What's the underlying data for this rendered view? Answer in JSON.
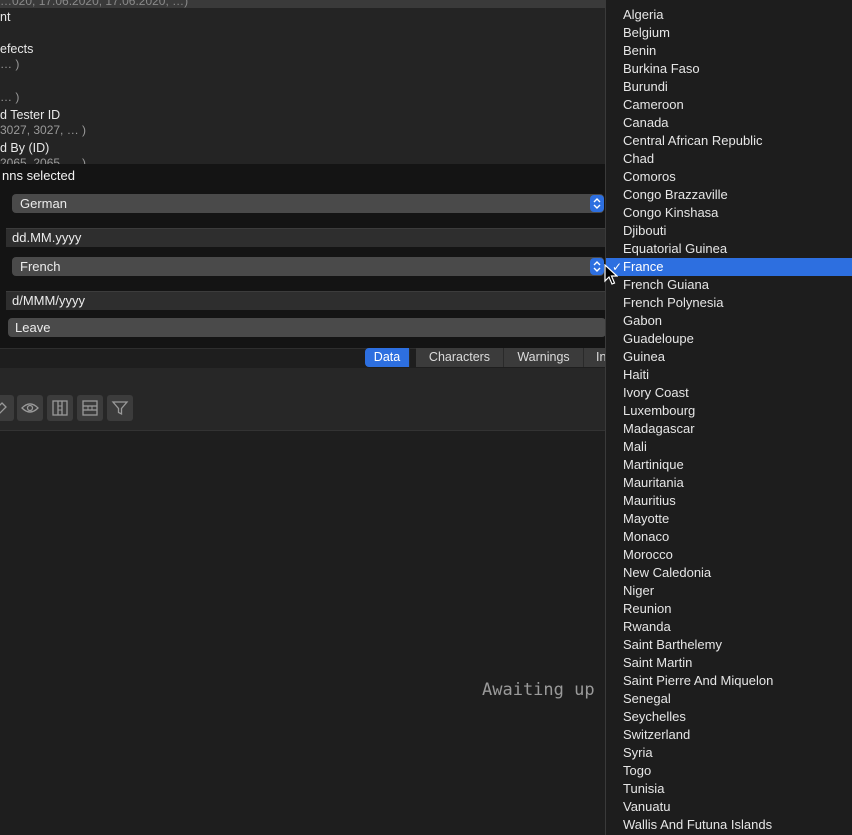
{
  "preview": {
    "top_sample": "…020, 17.06.2020, 17.06.2020, …)",
    "columns": [
      {
        "name": "nt",
        "sample": ""
      },
      {
        "name": "efects",
        "sample": "… )"
      },
      {
        "name": "",
        "sample": "… )"
      },
      {
        "name": "d Tester ID",
        "sample": "3027, 3027, … )"
      },
      {
        "name": "d By (ID)",
        "sample": "2065, 2065, … )"
      }
    ]
  },
  "settings": {
    "selection_label": "nns selected",
    "language_1": "German",
    "date_format_1": "dd.MM.yyyy",
    "language_2": "French",
    "date_format_2": "d/MMM/yyyy",
    "action": "Leave"
  },
  "tabs": [
    "Data",
    "Characters",
    "Warnings",
    "In"
  ],
  "active_tab": "Data",
  "toolbar": {
    "icons": [
      "pencil-icon",
      "eye-icon",
      "columns-icon",
      "rows-icon",
      "filter-icon"
    ]
  },
  "status": {
    "text": "Awaiting up"
  },
  "menu": {
    "selected": "France",
    "check_glyph": "✓",
    "items": [
      "Algeria",
      "Belgium",
      "Benin",
      "Burkina Faso",
      "Burundi",
      "Cameroon",
      "Canada",
      "Central African Republic",
      "Chad",
      "Comoros",
      "Congo Brazzaville",
      "Congo Kinshasa",
      "Djibouti",
      "Equatorial Guinea",
      "France",
      "French Guiana",
      "French Polynesia",
      "Gabon",
      "Guadeloupe",
      "Guinea",
      "Haiti",
      "Ivory Coast",
      "Luxembourg",
      "Madagascar",
      "Mali",
      "Martinique",
      "Mauritania",
      "Mauritius",
      "Mayotte",
      "Monaco",
      "Morocco",
      "New Caledonia",
      "Niger",
      "Reunion",
      "Rwanda",
      "Saint Barthelemy",
      "Saint Martin",
      "Saint Pierre And Miquelon",
      "Senegal",
      "Seychelles",
      "Switzerland",
      "Syria",
      "Togo",
      "Tunisia",
      "Vanuatu",
      "Wallis And Futuna Islands"
    ]
  },
  "colors": {
    "accent": "#2d6fe0",
    "background": "#1e1e1e",
    "menu_background": "#1d1d1d"
  }
}
